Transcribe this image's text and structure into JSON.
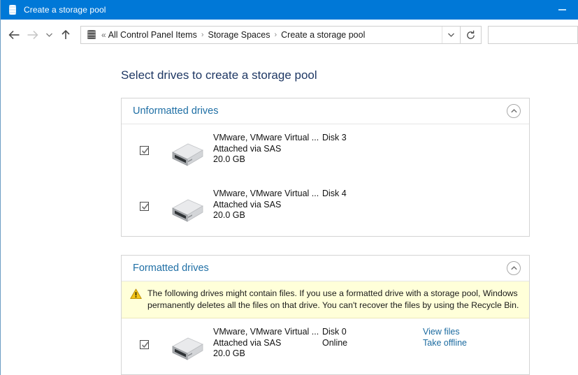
{
  "window": {
    "title": "Create a storage pool",
    "title_icon": "storage-disks-icon",
    "minimize_label": "Minimize"
  },
  "navbar": {
    "back_icon": "back-arrow-icon",
    "forward_icon": "forward-arrow-icon",
    "recent_icon": "recent-pages-chevron-icon",
    "up_icon": "up-arrow-icon",
    "address_icon": "storage-disks-icon",
    "overflow": "«",
    "breadcrumbs": [
      "All Control Panel Items",
      "Storage Spaces",
      "Create a storage pool"
    ],
    "separator": "›",
    "dropdown_icon": "chevron-down-icon",
    "refresh_icon": "refresh-icon",
    "search_value": "",
    "search_placeholder": ""
  },
  "main": {
    "page_title": "Select drives to create a storage pool",
    "sections": [
      {
        "id": "unformatted",
        "title": "Unformatted drives",
        "collapse_icon": "chevron-up-icon",
        "warning": null,
        "drives": [
          {
            "checked": true,
            "icon": "external-drive-icon",
            "name": "VMware, VMware Virtual ...",
            "attach": "Attached via SAS",
            "size": "20.0 GB",
            "disk": "Disk 3",
            "status": "",
            "links": []
          },
          {
            "checked": true,
            "icon": "external-drive-icon",
            "name": "VMware, VMware Virtual ...",
            "attach": "Attached via SAS",
            "size": "20.0 GB",
            "disk": "Disk 4",
            "status": "",
            "links": []
          }
        ]
      },
      {
        "id": "formatted",
        "title": "Formatted drives",
        "collapse_icon": "chevron-up-icon",
        "warning": {
          "icon": "warning-triangle-icon",
          "text": "The following drives might contain files. If you use a formatted drive with a storage pool, Windows permanently deletes all the files on that drive. You can't recover the files by using the Recycle Bin."
        },
        "drives": [
          {
            "checked": true,
            "icon": "external-drive-icon",
            "name": "VMware, VMware Virtual ...",
            "attach": "Attached via SAS",
            "size": "20.0 GB",
            "disk": "Disk 0",
            "status": "Online",
            "links": [
              "View files",
              "Take offline"
            ]
          }
        ]
      }
    ]
  },
  "colors": {
    "titlebar": "#0078d7",
    "heading": "#1f3864",
    "section_title": "#1f6fa5",
    "link": "#1c6ba0",
    "warning_bg": "#ffffd9",
    "warning_icon": "#f5c518"
  }
}
